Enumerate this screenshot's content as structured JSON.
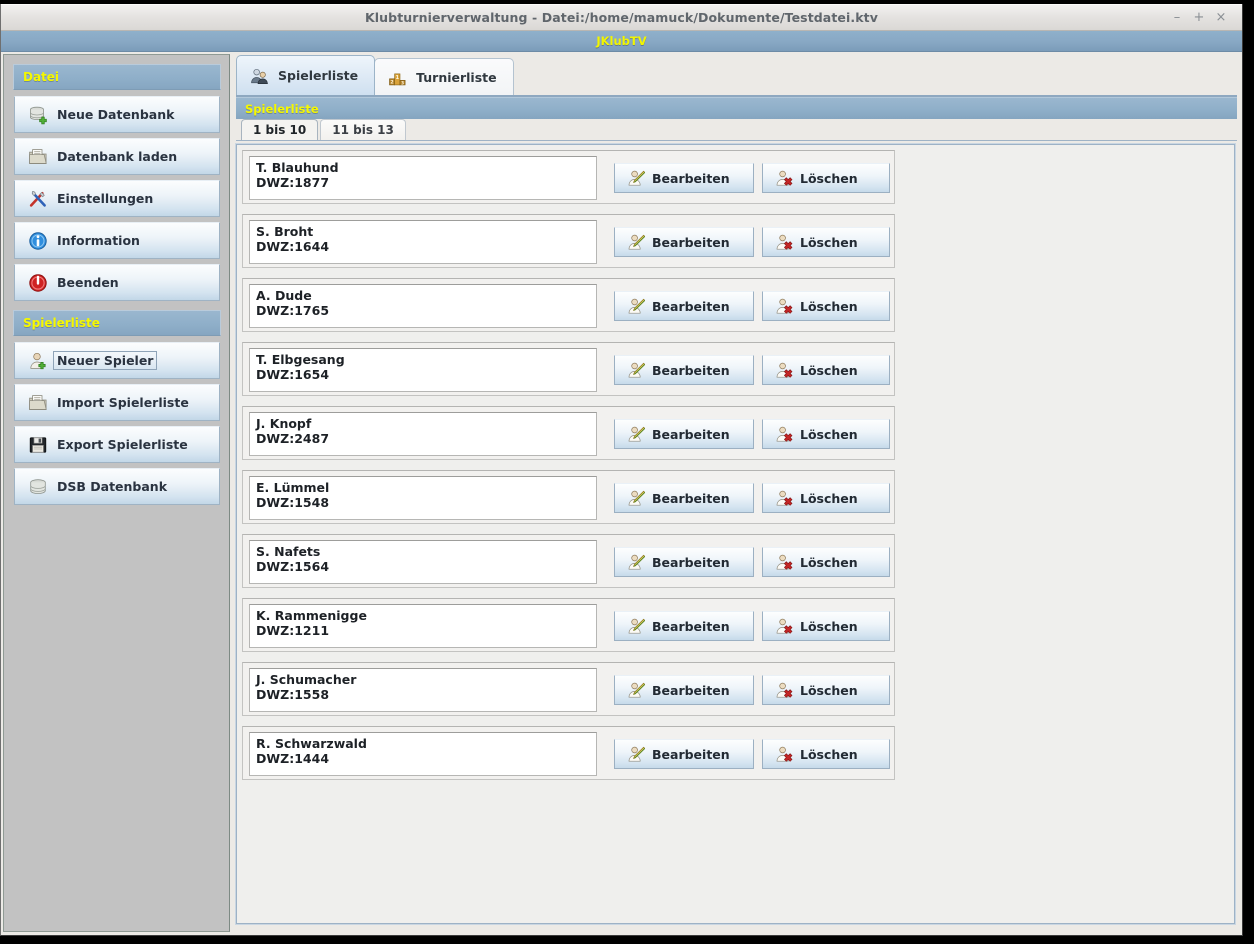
{
  "window": {
    "title": "Klubturnierverwaltung - Datei:/home/mamuck/Dokumente/Testdatei.ktv",
    "minimize_label": "–",
    "maximize_label": "+",
    "close_label": "×",
    "app_banner": "JKlubTV",
    "accent_blue": "#8fafc9",
    "accent_yellow": "#f5f800",
    "sidebar_gray": "#c2c2c2"
  },
  "sidebar": {
    "sections": [
      {
        "title": "Datei",
        "items": [
          {
            "label": "Neue Datenbank",
            "icon": "database-add-icon",
            "focused": false
          },
          {
            "label": "Datenbank laden",
            "icon": "folder-open-icon",
            "focused": false
          },
          {
            "label": "Einstellungen",
            "icon": "tools-icon",
            "focused": false
          },
          {
            "label": "Information",
            "icon": "info-icon",
            "focused": false
          },
          {
            "label": "Beenden",
            "icon": "power-icon",
            "focused": false
          }
        ]
      },
      {
        "title": "Spielerliste",
        "items": [
          {
            "label": "Neuer Spieler",
            "icon": "user-add-icon",
            "focused": true
          },
          {
            "label": "Import Spielerliste",
            "icon": "folder-open-icon",
            "focused": false
          },
          {
            "label": "Export Spielerliste",
            "icon": "floppy-save-icon",
            "focused": false
          },
          {
            "label": "DSB Datenbank",
            "icon": "database-icon",
            "focused": false
          }
        ]
      }
    ]
  },
  "main": {
    "tabs": [
      {
        "label": "Spielerliste",
        "icon": "two-users-icon",
        "active": true
      },
      {
        "label": "Turnierliste",
        "icon": "podium-icon",
        "active": false
      }
    ],
    "section_title": "Spielerliste",
    "subtabs": [
      {
        "label": "1 bis 10",
        "active": true
      },
      {
        "label": "11 bis 13",
        "active": false
      }
    ],
    "row_buttons": {
      "edit_label": "Bearbeiten",
      "edit_icon": "user-edit-icon",
      "delete_label": "Löschen",
      "delete_icon": "user-delete-icon"
    },
    "dwz_prefix": "DWZ:",
    "players": [
      {
        "name": "T. Blauhund",
        "dwz_label": "DWZ:1877",
        "dwz": 1877
      },
      {
        "name": "S. Broht",
        "dwz_label": "DWZ:1644",
        "dwz": 1644
      },
      {
        "name": "A. Dude",
        "dwz_label": "DWZ:1765",
        "dwz": 1765
      },
      {
        "name": "T. Elbgesang",
        "dwz_label": "DWZ:1654",
        "dwz": 1654
      },
      {
        "name": "J. Knopf",
        "dwz_label": "DWZ:2487",
        "dwz": 2487
      },
      {
        "name": "E. Lümmel",
        "dwz_label": "DWZ:1548",
        "dwz": 1548
      },
      {
        "name": "S. Nafets",
        "dwz_label": "DWZ:1564",
        "dwz": 1564
      },
      {
        "name": "K. Rammenigge",
        "dwz_label": "DWZ:1211",
        "dwz": 1211
      },
      {
        "name": "J. Schumacher",
        "dwz_label": "DWZ:1558",
        "dwz": 1558
      },
      {
        "name": "R. Schwarzwald",
        "dwz_label": "DWZ:1444",
        "dwz": 1444
      }
    ]
  }
}
